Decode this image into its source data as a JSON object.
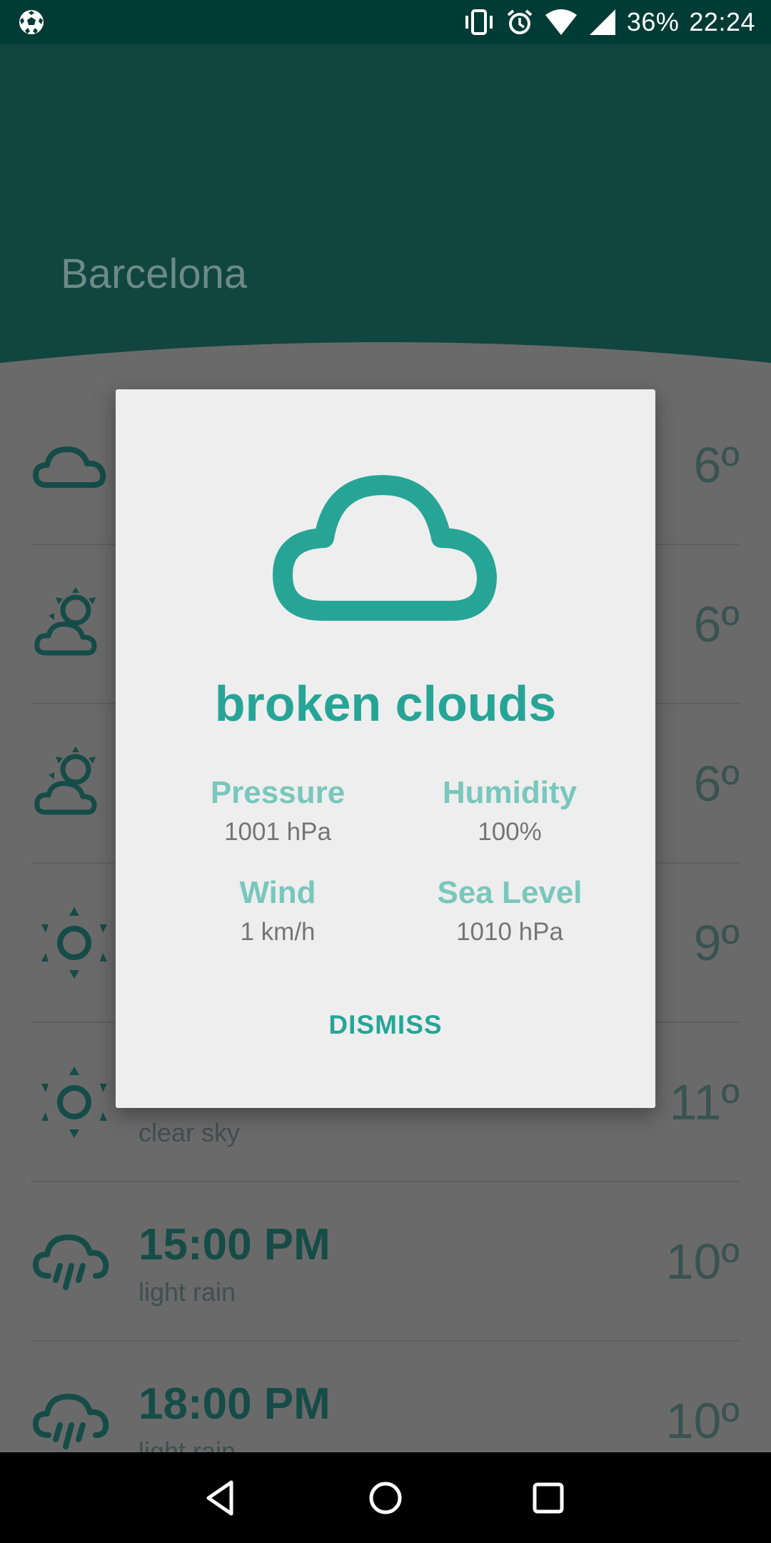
{
  "status_bar": {
    "battery": "36%",
    "time": "22:24",
    "icons": [
      "soccer-ball-icon",
      "vibrate-icon",
      "alarm-icon",
      "wifi-icon",
      "signal-icon"
    ]
  },
  "header": {
    "city": "Barcelona",
    "color": "#114540"
  },
  "forecast": [
    {
      "time": "",
      "desc": "",
      "temp": "6º",
      "icon": "cloud-icon"
    },
    {
      "time": "",
      "desc": "",
      "temp": "6º",
      "icon": "sun-cloud-icon"
    },
    {
      "time": "",
      "desc": "",
      "temp": "6º",
      "icon": "sun-cloud-icon"
    },
    {
      "time": "",
      "desc": "",
      "temp": "9º",
      "icon": "sun-icon"
    },
    {
      "time": "",
      "desc": "clear sky",
      "temp": "11º",
      "icon": "sun-icon"
    },
    {
      "time": "15:00 PM",
      "desc": "light rain",
      "temp": "10º",
      "icon": "rain-cloud-icon"
    },
    {
      "time": "18:00 PM",
      "desc": "light rain",
      "temp": "10º",
      "icon": "rain-cloud-icon"
    }
  ],
  "dialog": {
    "icon": "cloud-icon",
    "title": "broken clouds",
    "stats": [
      {
        "label": "Pressure",
        "value": "1001 hPa"
      },
      {
        "label": "Humidity",
        "value": "100%"
      },
      {
        "label": "Wind",
        "value": "1 km/h"
      },
      {
        "label": "Sea Level",
        "value": "1010 hPa"
      }
    ],
    "dismiss_label": "DISMISS",
    "accent": "#26a597"
  },
  "nav_bar": {
    "buttons": [
      "back-icon",
      "home-icon",
      "recents-icon"
    ]
  }
}
